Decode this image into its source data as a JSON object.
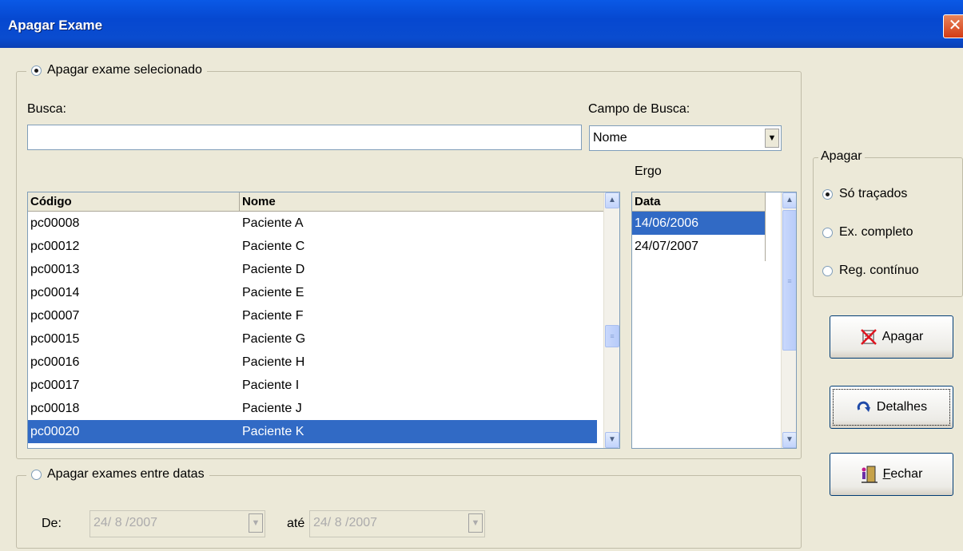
{
  "window": {
    "title": "Apagar Exame",
    "close_glyph": "✕"
  },
  "selected_group": {
    "legend": "Apagar exame selecionado",
    "checked": true,
    "search": {
      "label": "Busca:",
      "value": ""
    },
    "search_field": {
      "label": "Campo de Busca:",
      "value": "Nome"
    },
    "ergo_label": "Ergo",
    "patients": {
      "columns": [
        "Código",
        "Nome"
      ],
      "rows": [
        [
          "pc00008",
          "Paciente A"
        ],
        [
          "pc00012",
          "Paciente C"
        ],
        [
          "pc00013",
          "Paciente D"
        ],
        [
          "pc00014",
          "Paciente E"
        ],
        [
          "pc00007",
          "Paciente F"
        ],
        [
          "pc00015",
          "Paciente G"
        ],
        [
          "pc00016",
          "Paciente H"
        ],
        [
          "pc00017",
          "Paciente I"
        ],
        [
          "pc00018",
          "Paciente J"
        ],
        [
          "pc00020",
          "Paciente K"
        ]
      ],
      "selected_index": 9
    },
    "dates": {
      "column": "Data",
      "rows": [
        "14/06/2006",
        "24/07/2007"
      ],
      "selected_index": 0
    }
  },
  "range_group": {
    "legend": "Apagar exames entre datas",
    "checked": false,
    "from_label": "De:",
    "from_value": "24/ 8 /2007",
    "to_label": "até",
    "to_value": "24/ 8 /2007"
  },
  "delete_group": {
    "legend": "Apagar",
    "options": [
      {
        "label": "Só traçados",
        "checked": true
      },
      {
        "label": "Ex. completo",
        "checked": false
      },
      {
        "label": "Reg. contínuo",
        "checked": false
      }
    ]
  },
  "buttons": {
    "apagar": "Apagar",
    "detalhes": "Detalhes",
    "fechar": "Fechar"
  },
  "icons": {
    "apagar": "delete-document-icon",
    "detalhes": "refresh-arrow-icon",
    "fechar": "exit-door-icon"
  },
  "colors": {
    "selection": "#316ac5",
    "titlebar": "#0a59e6",
    "face": "#ece9d8"
  }
}
